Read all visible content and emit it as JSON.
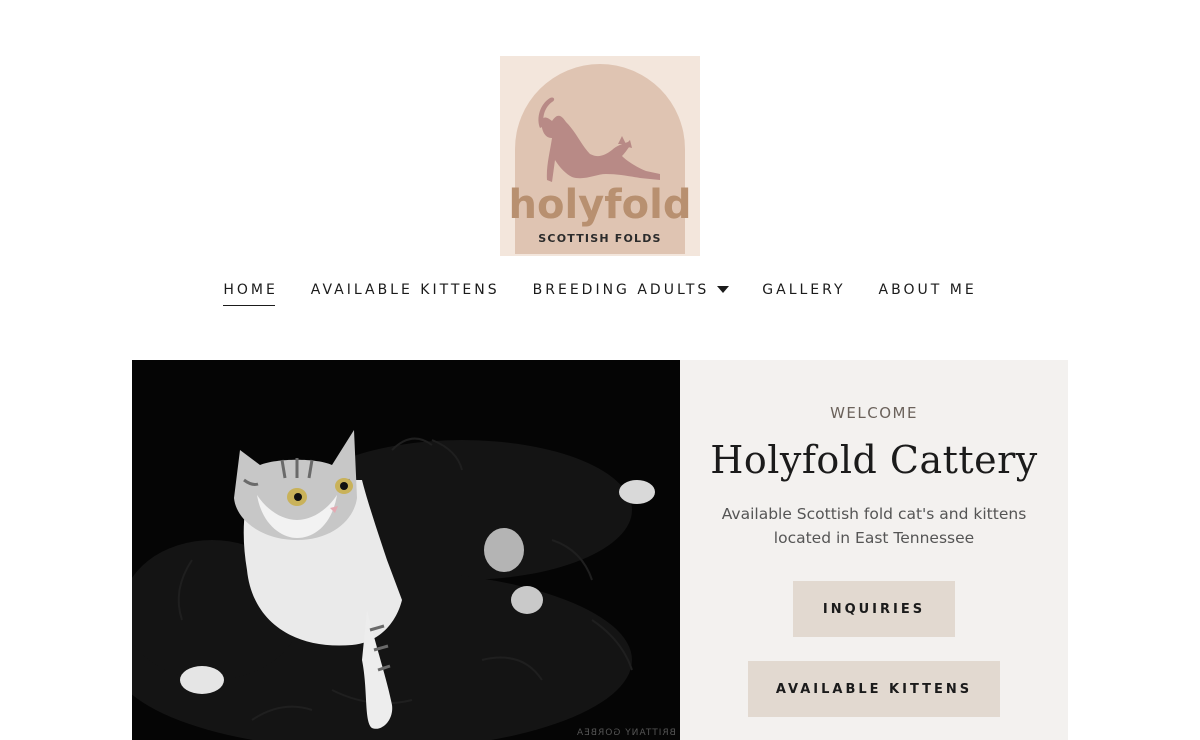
{
  "logo": {
    "wordmark": "holyfold",
    "tagline": "SCOTTISH FOLDS",
    "colors": {
      "background": "#f3e6dc",
      "arch": "#dfc4b2",
      "cat": "#b88a86",
      "wordmark": "#b89070",
      "tagline": "#2b2b2b"
    }
  },
  "nav": {
    "items": [
      {
        "label": "HOME",
        "active": true
      },
      {
        "label": "AVAILABLE KITTENS"
      },
      {
        "label": "BREEDING ADULTS",
        "dropdown": true
      },
      {
        "label": "GALLERY"
      },
      {
        "label": "ABOUT ME"
      }
    ]
  },
  "hero": {
    "eyebrow": "WELCOME",
    "title": "Holyfold Cattery",
    "subtitle": "Available Scottish fold cat's and kittens located in East Tennessee",
    "photo_credit": "BRITTANY GORBEA",
    "buttons": {
      "inquiries": "INQUIRIES",
      "available_kittens": "AVAILABLE KITTENS"
    },
    "colors": {
      "panel": "#f3f1ef",
      "button": "#e2d9d0"
    }
  }
}
